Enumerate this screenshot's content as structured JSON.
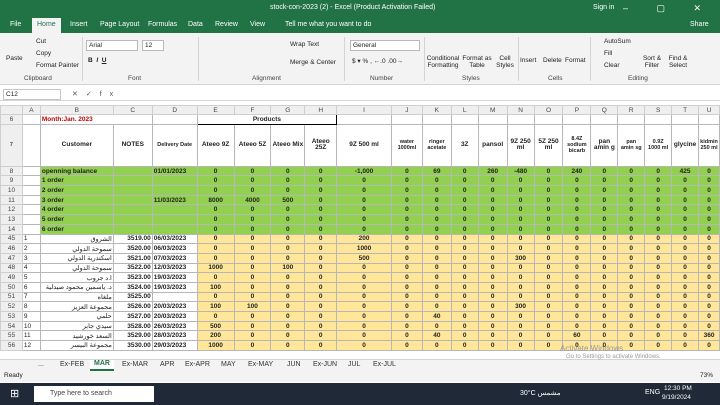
{
  "titlebar": {
    "title": "stock-con-2023 (2) - Excel (Product Activation Failed)",
    "signin": "Sign in",
    "controls": "– ▢ ✕"
  },
  "tabs": [
    "File",
    "Home",
    "Insert",
    "Page Layout",
    "Formulas",
    "Data",
    "Review",
    "View",
    "Tell me what you want to do",
    "Share"
  ],
  "ribbon": {
    "clipboard": {
      "paste": "Paste",
      "cut": "Cut",
      "copy": "Copy",
      "painter": "Format Painter",
      "label": "Clipboard"
    },
    "font": {
      "name": "Arial",
      "size": "12",
      "label": "Font"
    },
    "alignment": {
      "wrap": "Wrap Text",
      "merge": "Merge & Center",
      "label": "Alignment"
    },
    "number": {
      "format": "General",
      "label": "Number"
    },
    "styles": {
      "cond": "Conditional Formatting",
      "table": "Format as Table",
      "cell": "Cell Styles",
      "label": "Styles"
    },
    "cells": {
      "insert": "Insert",
      "delete": "Delete",
      "format": "Format",
      "label": "Cells"
    },
    "editing": {
      "autosum": "AutoSum",
      "fill": "Fill",
      "clear": "Clear",
      "sort": "Sort & Filter",
      "find": "Find & Select",
      "label": "Editing"
    }
  },
  "namebox": "C12",
  "columns": [
    "A",
    "B",
    "C",
    "D",
    "E",
    "F",
    "G",
    "H",
    "I",
    "J",
    "K",
    "L",
    "M",
    "N",
    "O",
    "P",
    "Q",
    "R",
    "S",
    "T",
    "U"
  ],
  "month_label": "Month:Jan. 2023",
  "products_label": "Products",
  "headers": [
    "Customer",
    "NOTES",
    "Delivery Date",
    "Ateeo 9Z",
    "Ateeo 5Z",
    "Ateeo Mix",
    "Ateeo 25Z",
    "9Z 500 ml",
    "water 1000ml",
    "ringer acetate",
    "3Z",
    "pansol",
    "9Z 250 ml",
    "5Z 250 ml",
    "8.4Z sodium bicarb",
    "pan amin g",
    "pan amin sg",
    "0.9Z 1000 ml",
    "glycine",
    "kidmin 250 ml"
  ],
  "rows": [
    {
      "r": "8",
      "cls": "g1",
      "b": "openning balance",
      "c": "",
      "d": "01/01/2023",
      "v": [
        "0",
        "0",
        "0",
        "0",
        "-1,000",
        "0",
        "69",
        "0",
        "260",
        "-480",
        "0",
        "240",
        "0",
        "0",
        "0",
        "425",
        "0"
      ]
    },
    {
      "r": "9",
      "cls": "g1",
      "b": "1 order",
      "c": "",
      "d": "",
      "v": [
        "0",
        "0",
        "0",
        "0",
        "0",
        "0",
        "0",
        "0",
        "0",
        "0",
        "0",
        "0",
        "0",
        "0",
        "0",
        "0",
        "0"
      ]
    },
    {
      "r": "10",
      "cls": "g1",
      "b": "2 order",
      "c": "",
      "d": "",
      "v": [
        "0",
        "0",
        "0",
        "0",
        "0",
        "0",
        "0",
        "0",
        "0",
        "0",
        "0",
        "0",
        "0",
        "0",
        "0",
        "0",
        "0"
      ]
    },
    {
      "r": "11",
      "cls": "g1",
      "b": "3 order",
      "c": "",
      "d": "11/03/2023",
      "v": [
        "8000",
        "4000",
        "500",
        "0",
        "0",
        "0",
        "0",
        "0",
        "0",
        "0",
        "0",
        "0",
        "0",
        "0",
        "0",
        "0",
        "0"
      ]
    },
    {
      "r": "12",
      "cls": "g1",
      "b": "4 order",
      "c": "",
      "d": "",
      "v": [
        "0",
        "0",
        "0",
        "0",
        "0",
        "0",
        "0",
        "0",
        "0",
        "0",
        "0",
        "0",
        "0",
        "0",
        "0",
        "0",
        "0"
      ]
    },
    {
      "r": "13",
      "cls": "g1",
      "b": "5 order",
      "c": "",
      "d": "",
      "v": [
        "0",
        "0",
        "0",
        "0",
        "0",
        "0",
        "0",
        "0",
        "0",
        "0",
        "0",
        "0",
        "0",
        "0",
        "0",
        "0",
        "0"
      ]
    },
    {
      "r": "14",
      "cls": "g1",
      "b": "6 order",
      "c": "",
      "d": "",
      "v": [
        "0",
        "0",
        "0",
        "0",
        "0",
        "0",
        "0",
        "0",
        "0",
        "0",
        "0",
        "0",
        "0",
        "0",
        "0",
        "0",
        "0"
      ]
    },
    {
      "r": "45",
      "cls": "y",
      "a": "1",
      "b": "الشروق",
      "c": "3519.00",
      "d": "06/03/2023",
      "v": [
        "0",
        "0",
        "0",
        "0",
        "200",
        "0",
        "0",
        "0",
        "0",
        "0",
        "0",
        "0",
        "0",
        "0",
        "0",
        "0",
        "0"
      ]
    },
    {
      "r": "46",
      "cls": "y",
      "a": "2",
      "b": "سموحة الدولي",
      "c": "3520.00",
      "d": "06/03/2023",
      "v": [
        "0",
        "0",
        "0",
        "0",
        "1000",
        "0",
        "0",
        "0",
        "0",
        "0",
        "0",
        "0",
        "0",
        "0",
        "0",
        "0",
        "0"
      ]
    },
    {
      "r": "47",
      "cls": "y",
      "a": "3",
      "b": "اسكندرية الدولي",
      "c": "3521.00",
      "d": "07/03/2023",
      "v": [
        "0",
        "0",
        "0",
        "0",
        "500",
        "0",
        "0",
        "0",
        "0",
        "300",
        "0",
        "0",
        "0",
        "0",
        "0",
        "0",
        "0"
      ]
    },
    {
      "r": "48",
      "cls": "y",
      "a": "4",
      "b": "سموحة الدولي",
      "c": "3522.00",
      "d": "12/03/2023",
      "v": [
        "1000",
        "0",
        "100",
        "0",
        "0",
        "0",
        "0",
        "0",
        "0",
        "0",
        "0",
        "0",
        "0",
        "0",
        "0",
        "0",
        "0"
      ]
    },
    {
      "r": "49",
      "cls": "y",
      "a": "5",
      "b": "ا.د جروب",
      "c": "3523.00",
      "d": "19/03/2023",
      "v": [
        "0",
        "0",
        "0",
        "0",
        "0",
        "0",
        "0",
        "0",
        "0",
        "0",
        "0",
        "0",
        "0",
        "0",
        "0",
        "0",
        "0"
      ]
    },
    {
      "r": "50",
      "cls": "y",
      "a": "6",
      "b": "د. ياسمين محمود صيدلية",
      "c": "3524.00",
      "d": "19/03/2023",
      "v": [
        "100",
        "0",
        "0",
        "0",
        "0",
        "0",
        "0",
        "0",
        "0",
        "0",
        "0",
        "0",
        "0",
        "0",
        "0",
        "0",
        "0"
      ]
    },
    {
      "r": "51",
      "cls": "y",
      "a": "7",
      "b": "ملغاه",
      "c": "3525.00",
      "d": "",
      "v": [
        "0",
        "0",
        "0",
        "0",
        "0",
        "0",
        "0",
        "0",
        "0",
        "0",
        "0",
        "0",
        "0",
        "0",
        "0",
        "0",
        "0"
      ]
    },
    {
      "r": "52",
      "cls": "y",
      "a": "8",
      "b": "مجموعة العزيز",
      "c": "3526.00",
      "d": "20/03/2023",
      "v": [
        "100",
        "100",
        "0",
        "0",
        "0",
        "0",
        "0",
        "0",
        "0",
        "300",
        "0",
        "0",
        "0",
        "0",
        "0",
        "0",
        "0"
      ]
    },
    {
      "r": "53",
      "cls": "y",
      "a": "9",
      "b": "حلمي",
      "c": "3527.00",
      "d": "20/03/2023",
      "v": [
        "0",
        "0",
        "0",
        "0",
        "0",
        "0",
        "40",
        "0",
        "0",
        "0",
        "0",
        "0",
        "0",
        "0",
        "0",
        "0",
        "0"
      ]
    },
    {
      "r": "54",
      "cls": "y",
      "a": "10",
      "b": "سيدي جابر",
      "c": "3528.00",
      "d": "26/03/2023",
      "v": [
        "500",
        "0",
        "0",
        "0",
        "0",
        "0",
        "0",
        "0",
        "0",
        "0",
        "0",
        "0",
        "0",
        "0",
        "0",
        "0",
        "0"
      ]
    },
    {
      "r": "55",
      "cls": "y",
      "a": "11",
      "b": "السعد خورشيد",
      "c": "3529.00",
      "d": "28/03/2023",
      "v": [
        "200",
        "0",
        "0",
        "0",
        "0",
        "0",
        "40",
        "0",
        "0",
        "0",
        "0",
        "60",
        "0",
        "0",
        "0",
        "0",
        "360"
      ]
    },
    {
      "r": "56",
      "cls": "y",
      "a": "12",
      "b": "مجموعة البيسر",
      "c": "3530.00",
      "d": "29/03/2023",
      "v": [
        "1000",
        "0",
        "0",
        "0",
        "0",
        "0",
        "0",
        "0",
        "0",
        "0",
        "0",
        "0",
        "0",
        "0",
        "0",
        "0",
        "0"
      ]
    }
  ],
  "sheets": [
    "...",
    "Ex-FEB",
    "MAR",
    "Ex-MAR",
    "APR",
    "Ex-APR",
    "MAY",
    "Ex-MAY",
    "JUN",
    "Ex-JUN",
    "JUL",
    "Ex-JUL"
  ],
  "status": {
    "ready": "Ready",
    "zoom": "73%"
  },
  "taskbar": {
    "search": "Type here to search",
    "weather": "30°C مشمس",
    "lang": "ENG",
    "time": "12:30 PM",
    "date": "9/19/2024"
  },
  "watermark": {
    "line1": "Activate Windows",
    "line2": "Go to Settings to activate Windows."
  }
}
